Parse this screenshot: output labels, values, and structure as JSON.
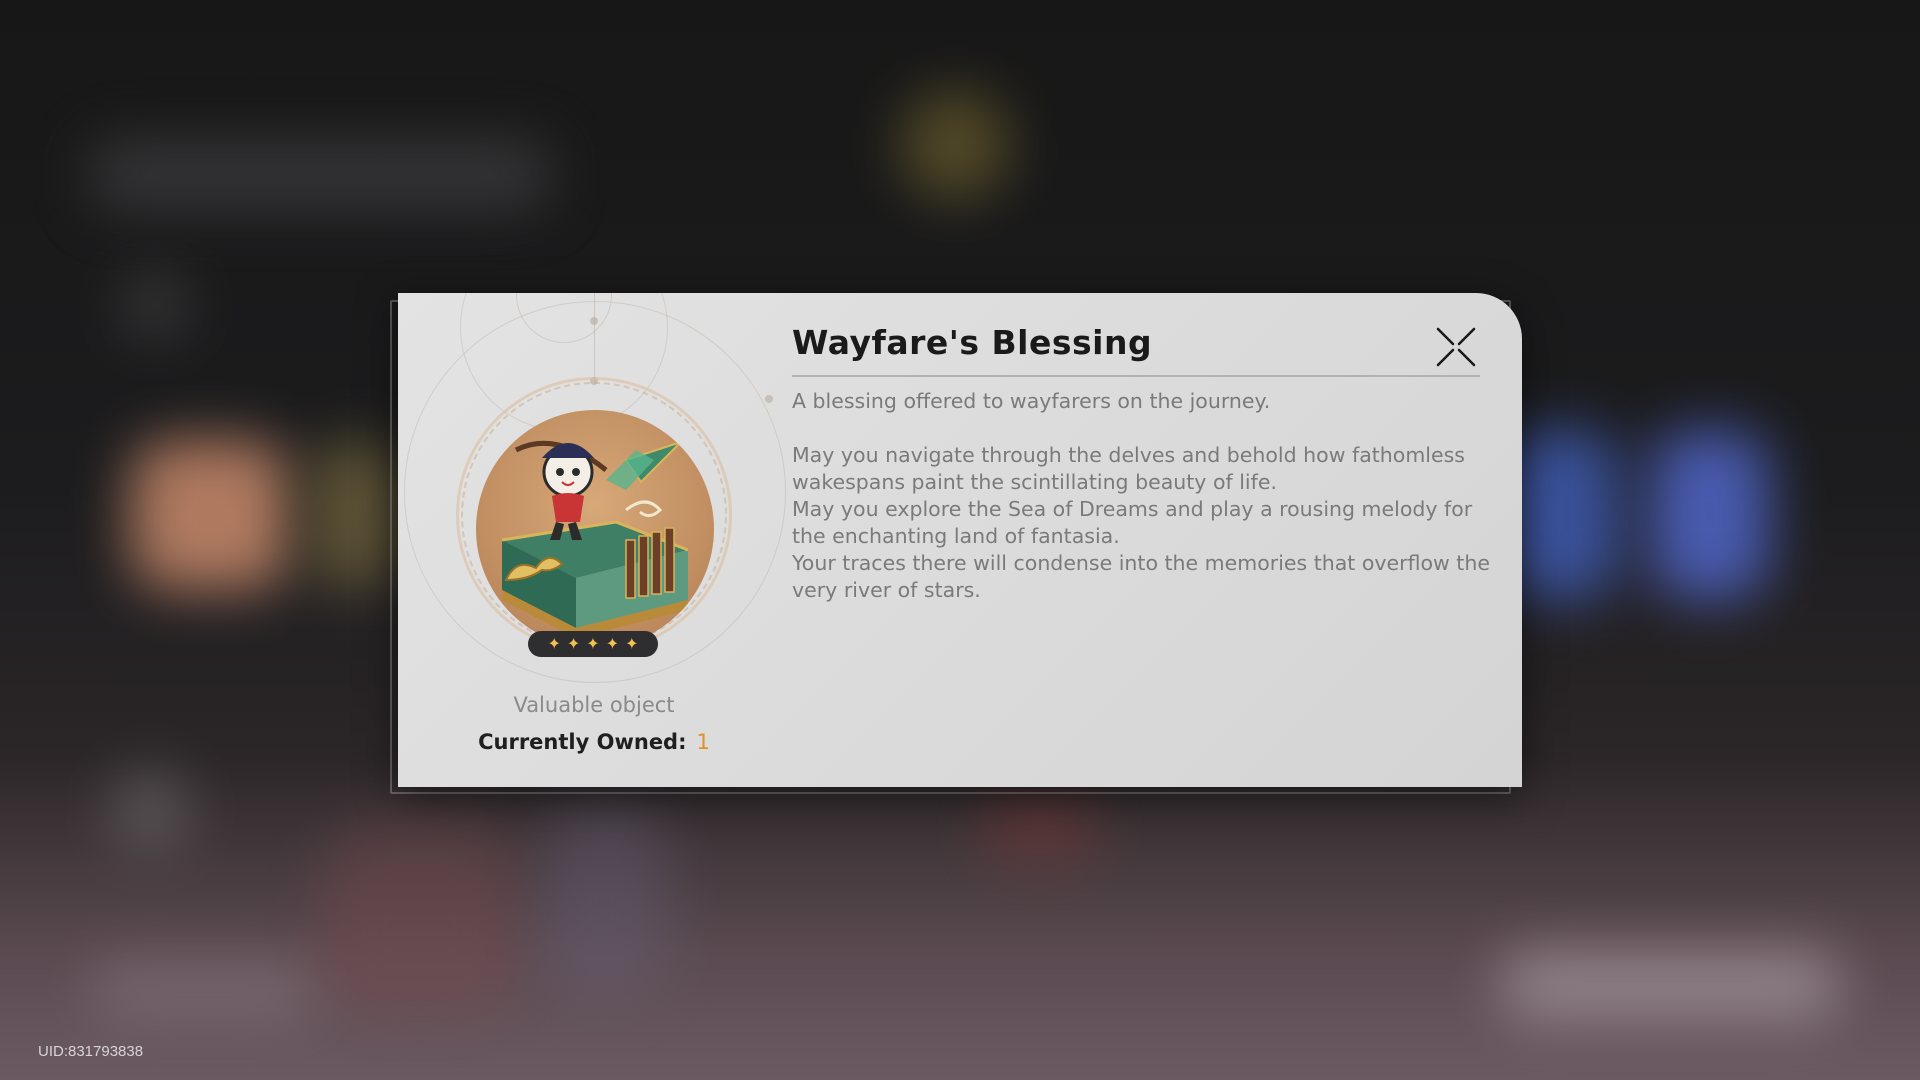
{
  "dialog": {
    "title": "Wayfare's Blessing",
    "summary": "A blessing offered to wayfarers on the journey.",
    "body": "May you navigate through the delves and behold how fathomless wakespans paint the scintillating beauty of life.\nMay you explore the Sea of Dreams and play a rousing melody for the enchanting land of fantasia.\nYour traces there will condense into the memories that overflow the very river of stars.",
    "close_icon": "close-x-icon"
  },
  "item": {
    "category": "Valuable object",
    "owned_label": "Currently Owned:",
    "owned_value": "1",
    "rarity_stars": 5,
    "star_glyph": "✦",
    "star_color": "#f2c14e",
    "icon": "wayfare-blessing-cake-icon"
  },
  "footer": {
    "uid": "UID:831793838"
  }
}
